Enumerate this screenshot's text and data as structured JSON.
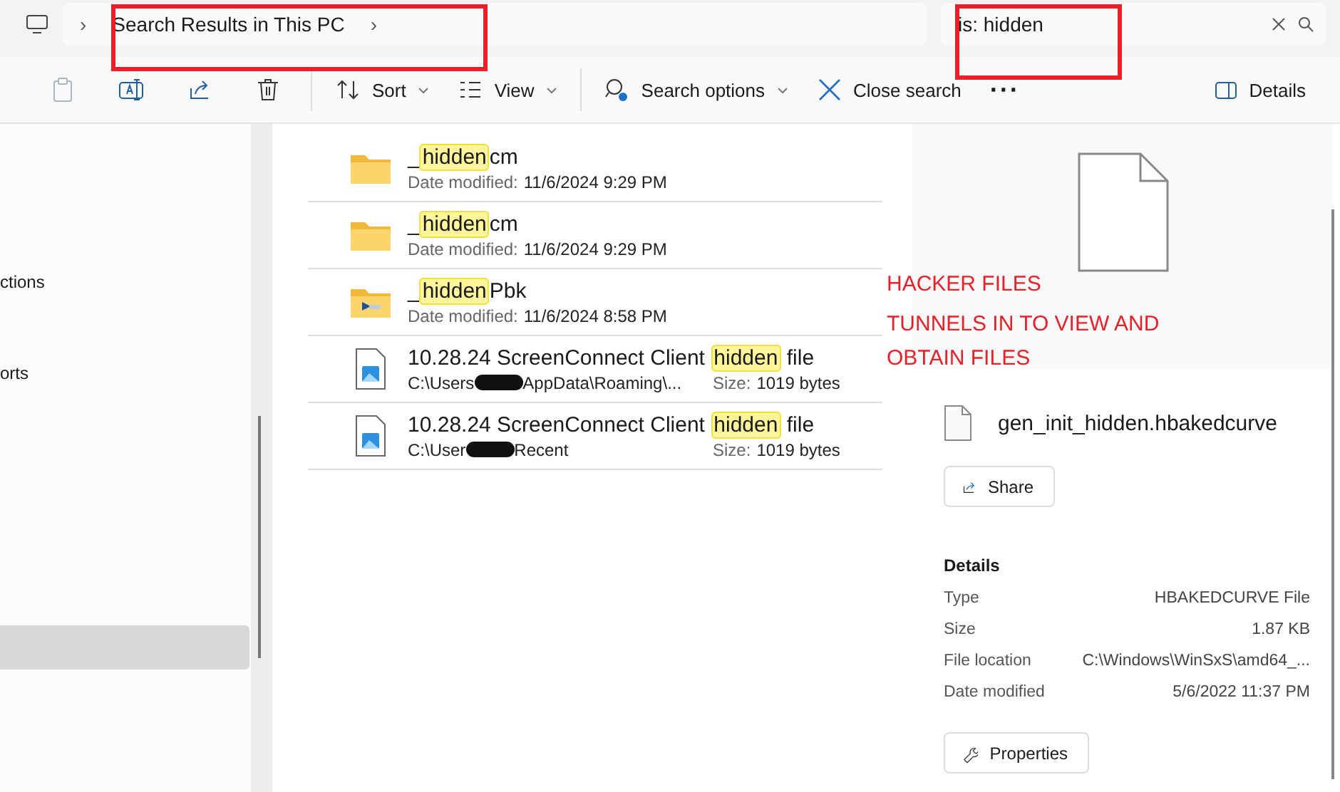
{
  "address_bar": {
    "items": [
      {
        "kind": "chevron",
        "text": "›"
      },
      {
        "kind": "crumb",
        "text": "Search Results in This PC"
      },
      {
        "kind": "chevron",
        "text": "›"
      }
    ],
    "annotated": true
  },
  "search": {
    "value": "is: hidden",
    "annotated": true
  },
  "toolbar": [
    {
      "kind": "paste",
      "disabled": true
    },
    {
      "kind": "rename",
      "disabled": false
    },
    {
      "kind": "share",
      "disabled": false
    },
    {
      "kind": "delete",
      "disabled": false
    },
    {
      "kind": "sep"
    },
    {
      "kind": "sort",
      "label": "Sort"
    },
    {
      "kind": "view",
      "label": "View"
    },
    {
      "kind": "sep"
    },
    {
      "kind": "search-options",
      "label": "Search options"
    },
    {
      "kind": "close-search",
      "label": "Close search"
    },
    {
      "kind": "more",
      "label": "···"
    }
  ],
  "details_toggle": {
    "label": "Details"
  },
  "sidebar": {
    "items": [
      {
        "label": "ctions",
        "selected": false
      },
      {
        "label": "orts",
        "selected": false
      },
      {
        "selected": true
      }
    ]
  },
  "results": [
    {
      "kind": "folder",
      "name": [
        "_",
        "hidden",
        "cm"
      ],
      "meta_label": "Date modified:",
      "meta_value": "11/6/2024 9:29 PM"
    },
    {
      "kind": "folder",
      "name": [
        "_",
        "hidden",
        "cm"
      ],
      "meta_label": "Date modified:",
      "meta_value": "11/6/2024 9:29 PM"
    },
    {
      "kind": "shortcut-folder",
      "name": [
        "_",
        "hidden",
        "Pbk"
      ],
      "meta_label": "Date modified:",
      "meta_value": "11/6/2024 8:58 PM"
    },
    {
      "kind": "image-file",
      "name": [
        "10.28.24 ScreenConnect Client ",
        "hidden",
        " file"
      ],
      "path_start": "C:\\Users",
      "path_end": "AppData\\Roaming\\...",
      "size_label": "Size:",
      "size_value": "1019 bytes"
    },
    {
      "kind": "image-file",
      "name": [
        "10.28.24 ScreenConnect Client ",
        "hidden",
        " file"
      ],
      "path_start": "C:\\User",
      "path_end": "Recent",
      "size_label": "Size:",
      "size_value": "1019 bytes"
    }
  ],
  "notes": [
    "HACKER FILES",
    "TUNNELS IN TO VIEW AND OBTAIN FILES"
  ],
  "details_pane": {
    "file_name": "gen_init_hidden.hbakedcurve",
    "share": "Share",
    "heading": "Details",
    "properties": [
      {
        "label": "Type",
        "value": "HBAKEDCURVE File"
      },
      {
        "label": "Size",
        "value": "1.87 KB"
      },
      {
        "label": "File location",
        "value": "C:\\Windows\\WinSxS\\amd64_..."
      },
      {
        "label": "Date modified",
        "value": "5/6/2022 11:37 PM"
      }
    ],
    "properties_button": "Properties"
  }
}
